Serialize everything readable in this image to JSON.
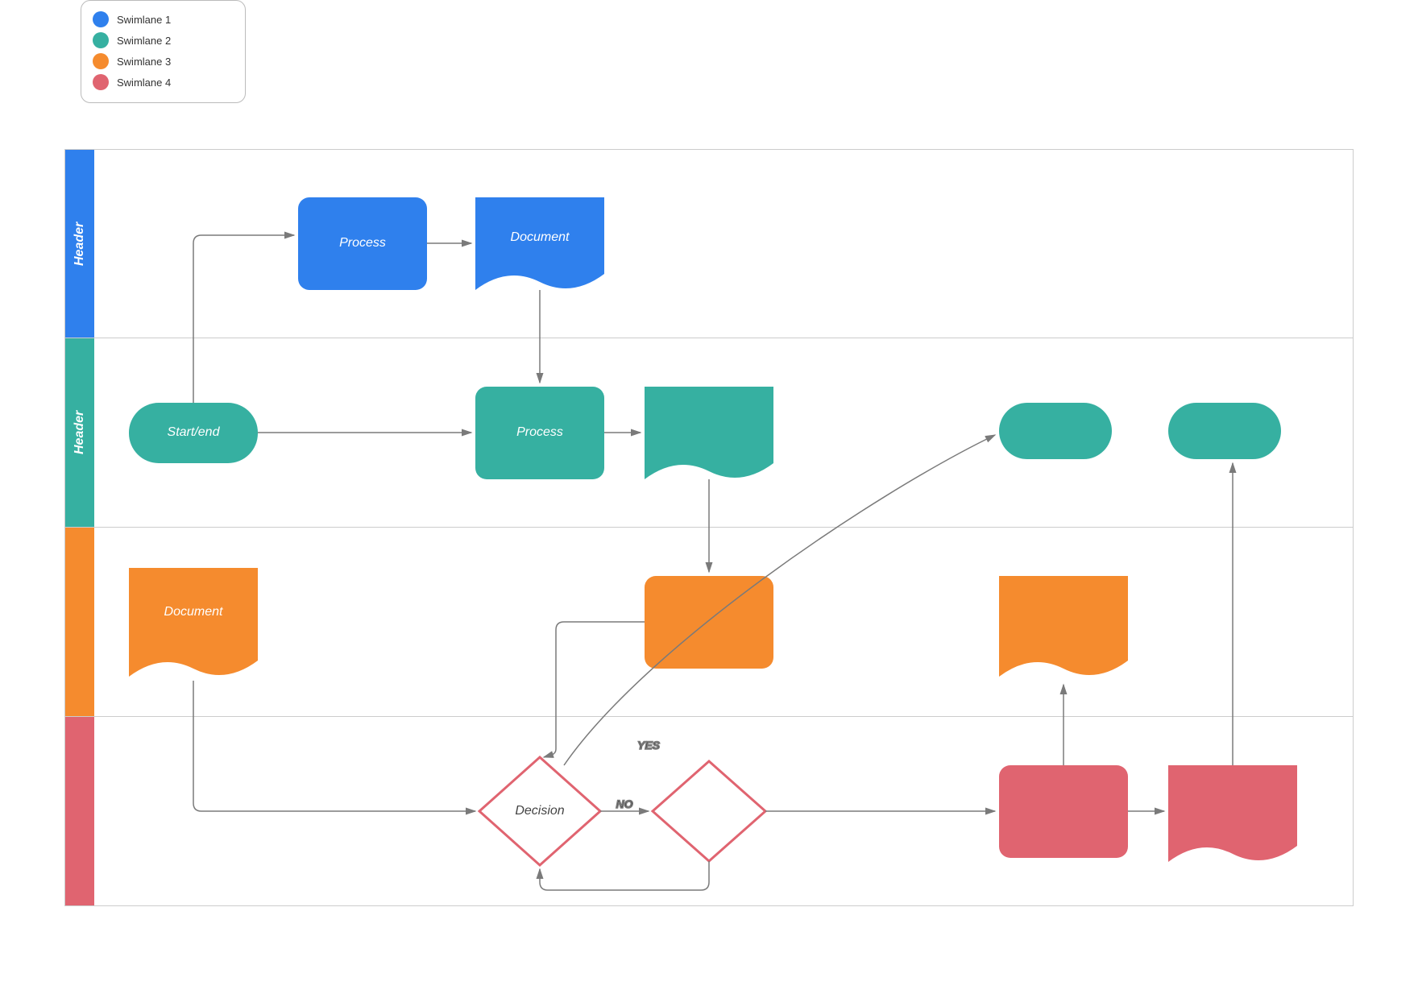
{
  "legend": {
    "items": [
      {
        "label": "Swimlane 1",
        "color": "#2F80ED"
      },
      {
        "label": "Swimlane 2",
        "color": "#36B0A1"
      },
      {
        "label": "Swimlane 3",
        "color": "#F58B2E"
      },
      {
        "label": "Swimlane 4",
        "color": "#E06470"
      }
    ]
  },
  "lanes": [
    {
      "header": "Header",
      "color": "#2F80ED"
    },
    {
      "header": "Header",
      "color": "#36B0A1"
    },
    {
      "header": "",
      "color": "#F58B2E"
    },
    {
      "header": "",
      "color": "#E06470"
    }
  ],
  "nodes": {
    "process_blue": "Process",
    "document_blue": "Document",
    "startend_teal": "Start/end",
    "process_teal": "Process",
    "document_orange": "Document",
    "decision1": "Decision"
  },
  "edges": {
    "yes": "YES",
    "no": "NO"
  },
  "colors": {
    "blue": "#2F80ED",
    "teal": "#36B0A1",
    "orange": "#F58B2E",
    "red": "#E06470",
    "line": "#7a7a7a"
  }
}
